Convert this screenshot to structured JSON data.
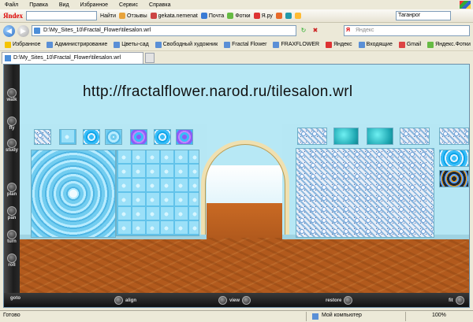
{
  "menu": [
    "Файл",
    "Правка",
    "Вид",
    "Избранное",
    "Сервис",
    "Справка"
  ],
  "ytoolbar": {
    "logo": "Яndex",
    "find": "Найти",
    "items": [
      "Отзывы",
      "gekata.nemenat",
      "Почта",
      "Фотки",
      "Я.ру"
    ],
    "city": "Таганрог"
  },
  "address": {
    "url": "D:\\My_Sites_10\\Fractal_Flower\\tilesalon.wrl",
    "search_placeholder": "Яндекс"
  },
  "favorites": {
    "label": "Избранное",
    "items": [
      "Администрирование",
      "Цветы-сад",
      "Свободный художник",
      "Fractal Flower",
      "FRAXFLOWER",
      "Яндекс",
      "Входящие",
      "Gmail",
      "Яндекс.Фотки"
    ]
  },
  "tab": {
    "title": "D:\\My_Sites_10\\Fractal_Flower\\tilesalon.wrl"
  },
  "viewer": {
    "banner": "http://fractalflower.narod.ru/tilesalon.wrl",
    "side_buttons": [
      "walk",
      "fly",
      "study",
      "plan",
      "pan",
      "turn",
      "roll"
    ],
    "bottom_buttons": {
      "goto": "goto",
      "align": "align",
      "view": "view",
      "restore": "restore",
      "fit": "fit"
    }
  },
  "status": {
    "left": "Готово",
    "zone": "Мой компьютер",
    "zoom": "100%"
  },
  "colors": {
    "wall": "#b6e7f4",
    "floor": "#b25a1d",
    "arch": "#efe0b0"
  }
}
